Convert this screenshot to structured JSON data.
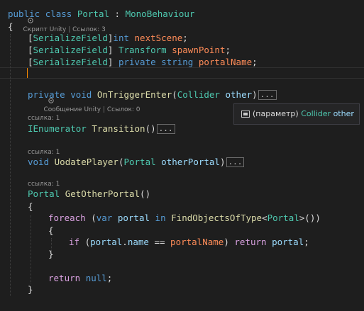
{
  "class_lens": {
    "label": "Скрипт Unity",
    "refs": "Ссылок: 3"
  },
  "code": {
    "class_decl": {
      "kw1": "public",
      "kw2": "class",
      "name": "Portal",
      "colon": " : ",
      "base": "MonoBehaviour"
    },
    "open_brace": "{",
    "close_brace": "}",
    "fields": [
      {
        "attr": "SerializeField",
        "pre": "",
        "type": "int",
        "type_is_kw": true,
        "mods": "",
        "name": "nextScene"
      },
      {
        "attr": "SerializeField",
        "pre": " ",
        "type": "Transform",
        "type_is_kw": false,
        "mods": "",
        "name": "spawnPoint"
      },
      {
        "attr": "SerializeField",
        "pre": " ",
        "type": "string",
        "type_is_kw": true,
        "mods": "private ",
        "name": "portalName"
      }
    ],
    "trigger_lens": {
      "label": "Сообщение Unity",
      "refs": "Ссылок: 0"
    },
    "trigger": {
      "mod": "private",
      "ret": "void",
      "name": "OnTriggerEnter",
      "ptype": "Collider",
      "pname": "other",
      "fold": "..."
    },
    "transition_lens": "ссылка: 1",
    "transition": {
      "ret": "IEnumerator",
      "name": "Transition",
      "parens": "()",
      "fold": "..."
    },
    "update_lens": "ссылка: 1",
    "update": {
      "ret": "void",
      "name": "UodatePlayer",
      "ptype": "Portal",
      "pname": "otherPortal",
      "fold": "..."
    },
    "getother_lens": "ссылка: 1",
    "getother": {
      "ret": "Portal",
      "name": "GetOtherPortal",
      "parens": "()",
      "foreach": "foreach",
      "var": "var",
      "iter": "portal",
      "in": "in",
      "call": "FindObjectsOfType",
      "generic": "Portal",
      "if": "if",
      "member": "name",
      "op": "==",
      "field": "portalName",
      "ret_kw": "return",
      "ret_val": "portal",
      "null_kw": "null"
    }
  },
  "tooltip": {
    "kind": "(параметр)",
    "type": "Collider",
    "name": "other"
  },
  "colors": {
    "keyword": "#569cd6",
    "type": "#4ec9b0",
    "method": "#dcdcaa",
    "parameter": "#9cdcfe",
    "field": "#ff8c58",
    "control": "#d8a0df",
    "background": "#1e1e1e"
  },
  "icons": {
    "lens": "unity-script-icon",
    "tooltip": "parameter-icon"
  }
}
